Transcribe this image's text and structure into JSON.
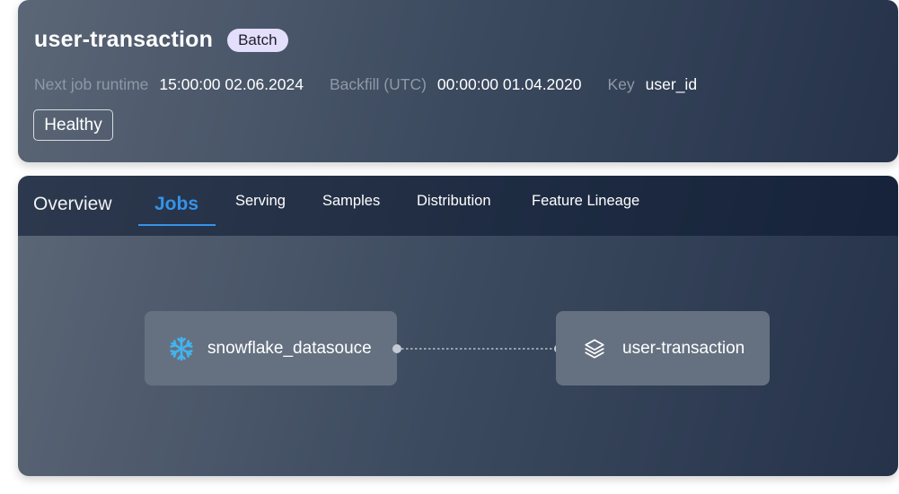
{
  "header": {
    "title": "user-transaction",
    "badge": "Batch",
    "meta": [
      {
        "label": "Next job runtime",
        "value": "15:00:00 02.06.2024"
      },
      {
        "label": "Backfill (UTC)",
        "value": "00:00:00 01.04.2020"
      },
      {
        "label": "Key",
        "value": "user_id"
      }
    ],
    "status": "Healthy"
  },
  "tabs": {
    "overview": "Overview",
    "jobs": "Jobs",
    "serving": "Serving",
    "samples": "Samples",
    "distribution": "Distribution",
    "feature_lineage": "Feature Lineage",
    "active": "Jobs"
  },
  "lineage": {
    "source": {
      "label": "snowflake_datasouce",
      "icon": "snowflake-icon",
      "icon_color": "#42b4f0"
    },
    "target": {
      "label": "user-transaction",
      "icon": "layers-icon"
    }
  },
  "colors": {
    "accent": "#3593ea",
    "badge_bg": "#e3defb",
    "card_start": "#5b6676",
    "card_end": "#25324a"
  }
}
